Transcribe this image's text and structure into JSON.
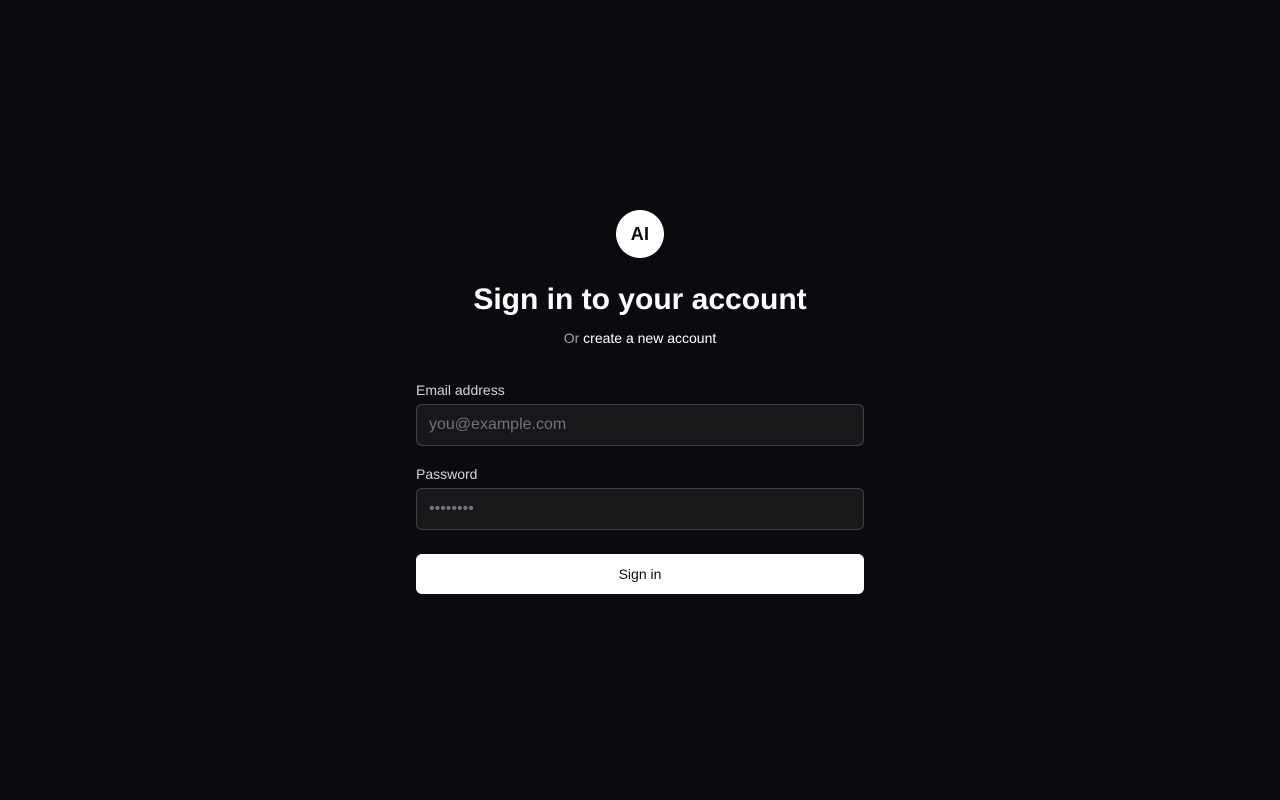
{
  "logo": {
    "text": "AI"
  },
  "heading": "Sign in to your account",
  "subtitle": {
    "prefix": "Or",
    "link": "create a new account"
  },
  "email": {
    "label": "Email address",
    "placeholder": "you@example.com",
    "value": ""
  },
  "password": {
    "label": "Password",
    "placeholder": "••••••••",
    "value": ""
  },
  "submit_label": "Sign in",
  "colors": {
    "background": "#0b0b0f",
    "input_background": "#18181b",
    "input_border": "#3f3f46",
    "muted_text": "#a1a1aa",
    "primary": "#ffffff"
  }
}
